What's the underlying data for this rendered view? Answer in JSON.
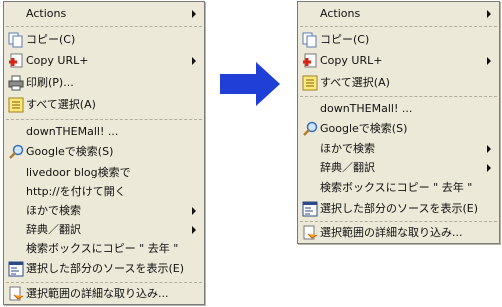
{
  "left_menu": {
    "items": [
      {
        "label": "Actions",
        "icon": "",
        "submenu": true
      },
      {
        "label": "コピー(C)",
        "icon": "copy-icon",
        "submenu": false
      },
      {
        "label": "Copy URL+",
        "icon": "copy-url-icon",
        "submenu": true
      },
      {
        "label": "印刷(P)...",
        "icon": "print-icon",
        "submenu": false
      },
      {
        "label": "すべて選択(A)",
        "icon": "select-all-icon",
        "submenu": false
      },
      {
        "label": "downTHEMall! ...",
        "icon": "",
        "submenu": false
      },
      {
        "label": "Googleで検索(S)",
        "icon": "magnifier-icon",
        "submenu": false
      },
      {
        "label": "livedoor blog検索で",
        "icon": "",
        "submenu": false
      },
      {
        "label": "http://を付けて開く",
        "icon": "",
        "submenu": false
      },
      {
        "label": "ほかで検索",
        "icon": "",
        "submenu": true
      },
      {
        "label": "辞典／翻訳",
        "icon": "",
        "submenu": true
      },
      {
        "label": "検索ボックスにコピー \" 去年 \"",
        "icon": "",
        "submenu": false
      },
      {
        "label": "選択した部分のソースを表示(E)",
        "icon": "view-source-icon",
        "submenu": false
      },
      {
        "label": "選択範囲の詳細な取り込み...",
        "icon": "capture-icon",
        "submenu": false
      }
    ]
  },
  "right_menu": {
    "items": [
      {
        "label": "Actions",
        "icon": "",
        "submenu": true
      },
      {
        "label": "コピー(C)",
        "icon": "copy-icon",
        "submenu": false
      },
      {
        "label": "Copy URL+",
        "icon": "copy-url-icon",
        "submenu": true
      },
      {
        "label": "すべて選択(A)",
        "icon": "select-all-icon",
        "submenu": false
      },
      {
        "label": "downTHEMall! ...",
        "icon": "",
        "submenu": false
      },
      {
        "label": "Googleで検索(S)",
        "icon": "magnifier-icon",
        "submenu": false
      },
      {
        "label": "ほかで検索",
        "icon": "",
        "submenu": true
      },
      {
        "label": "辞典／翻訳",
        "icon": "",
        "submenu": true
      },
      {
        "label": "検索ボックスにコピー \" 去年 \"",
        "icon": "",
        "submenu": false
      },
      {
        "label": "選択した部分のソースを表示(E)",
        "icon": "view-source-icon",
        "submenu": false
      },
      {
        "label": "選択範囲の詳細な取り込み...",
        "icon": "capture-icon",
        "submenu": false
      }
    ]
  },
  "colors": {
    "menu_background": "#ece9d8",
    "arrow_blue": "#1f3fd6"
  }
}
